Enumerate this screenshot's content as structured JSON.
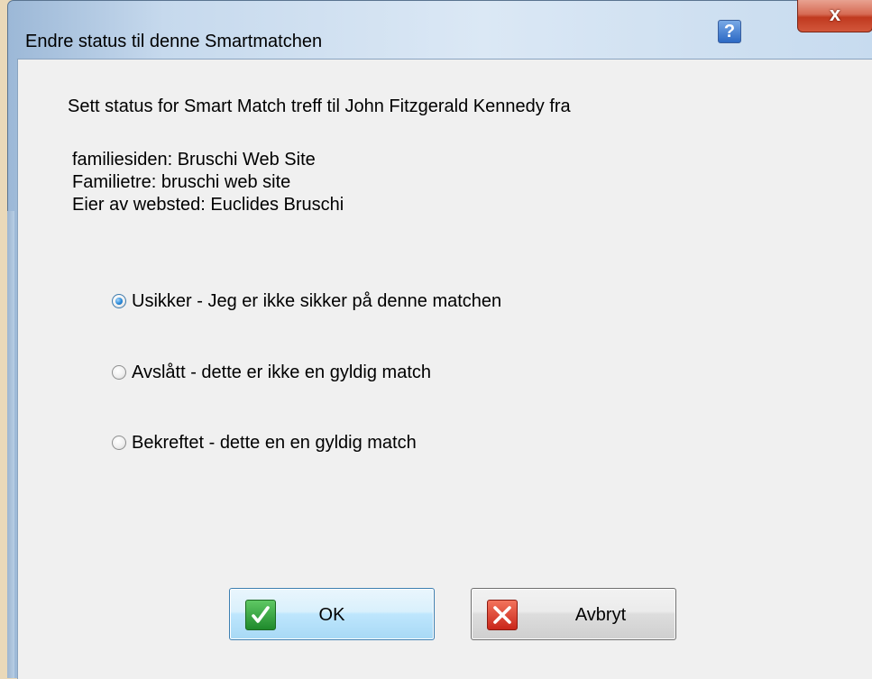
{
  "window": {
    "title": "Endre status til denne Smartmatchen",
    "help_label": "?",
    "close_label": "x"
  },
  "dialog": {
    "intro": "Sett status for Smart Match treff til John Fitzgerald Kennedy fra",
    "details": [
      "familiesiden: Bruschi Web Site",
      "Familietre: bruschi web site",
      "Eier av websted: Euclides Bruschi"
    ],
    "options": [
      {
        "label": "Usikker - Jeg er ikke sikker på denne matchen",
        "checked": true
      },
      {
        "label": "Avslått - dette er ikke en gyldig match",
        "checked": false
      },
      {
        "label": "Bekreftet - dette en en gyldig match",
        "checked": false
      }
    ]
  },
  "buttons": {
    "ok_label": "OK",
    "cancel_label": "Avbryt"
  },
  "colors": {
    "title_bar": "#dbe8f5",
    "client_background": "#f0f0f0",
    "close_button": "#c0391f",
    "help_button": "#2c69c4",
    "ok_icon": "#1f8a2c",
    "cancel_icon": "#c9261a",
    "radio_selected": "#2a8ad8"
  },
  "icons": {
    "help": "question-mark-icon",
    "close": "close-icon",
    "ok": "checkmark-icon",
    "cancel": "x-mark-icon"
  }
}
